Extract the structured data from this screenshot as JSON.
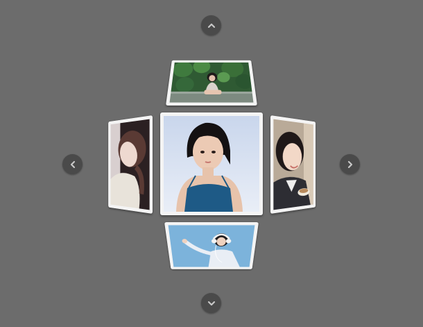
{
  "carousel": {
    "nav": {
      "up": "chevron-up-icon",
      "down": "chevron-down-icon",
      "left": "chevron-left-icon",
      "right": "chevron-right-icon"
    },
    "photos": {
      "top": "photo-girl-sitting-outdoors",
      "left": "photo-girl-with-head-tilted",
      "center": "photo-girl-in-blue-top",
      "right": "photo-girl-smiling-with-coffee",
      "bottom": "photo-girl-with-headphones"
    }
  },
  "colors": {
    "background": "#6c6c6c",
    "nav_button": "#4a4a4a",
    "card_frame": "#f4f4f4"
  }
}
